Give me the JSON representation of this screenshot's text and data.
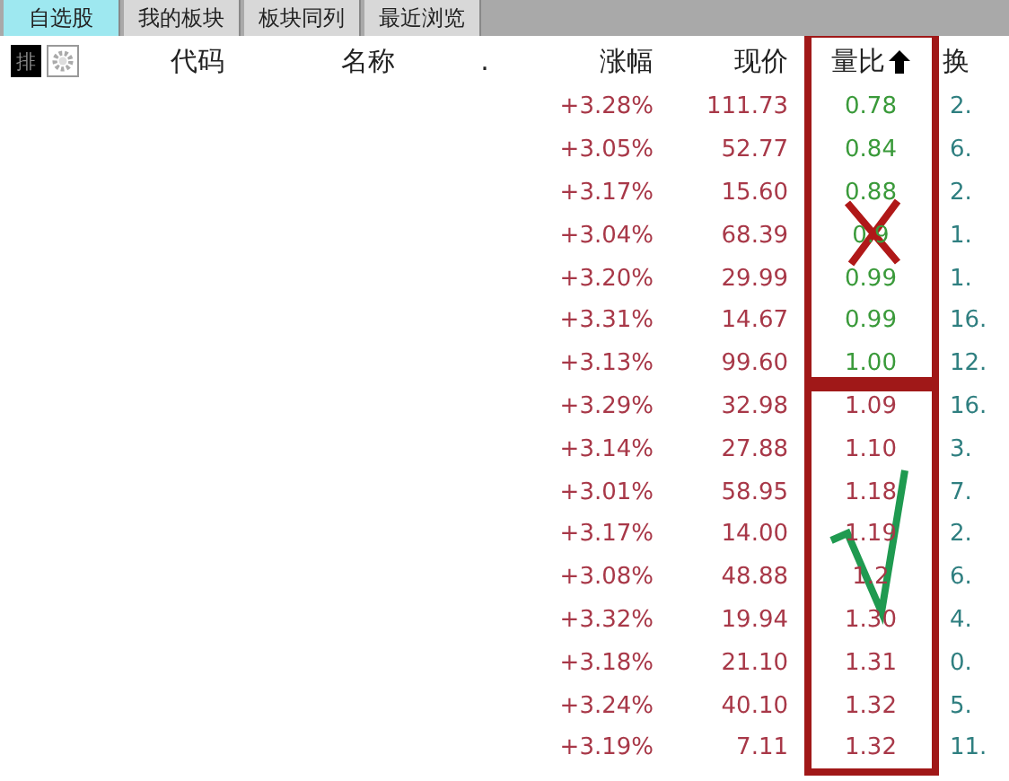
{
  "tabs": [
    {
      "label": "自选股",
      "selected": true
    },
    {
      "label": "我的板块",
      "selected": false
    },
    {
      "label": "板块同列",
      "selected": false
    },
    {
      "label": "最近浏览",
      "selected": false
    }
  ],
  "toolbar": {
    "sort_key": "排"
  },
  "columns": [
    {
      "label": "代码",
      "sorted": false
    },
    {
      "label": "名称",
      "sorted": false
    },
    {
      "label": ".",
      "sorted": false
    },
    {
      "label": "涨幅",
      "sorted": false
    },
    {
      "label": "现价",
      "sorted": false
    },
    {
      "label": "量比",
      "sorted": true
    },
    {
      "label": "换",
      "sorted": false
    }
  ],
  "rows": [
    {
      "change": "+3.28%",
      "price": "111.73",
      "ratio": "0.78",
      "color": "#3a9a3a",
      "column_7": "2."
    },
    {
      "change": "+3.05%",
      "price": "52.77",
      "ratio": "0.84",
      "color": "#3a9a3a",
      "column_7": "6."
    },
    {
      "change": "+3.17%",
      "price": "15.60",
      "ratio": "0.88",
      "color": "#3a9a3a",
      "column_7": "2."
    },
    {
      "change": "+3.04%",
      "price": "68.39",
      "ratio": "0.9",
      "color": "#3a9a3a",
      "column_7": "1."
    },
    {
      "change": "+3.20%",
      "price": "29.99",
      "ratio": "0.99",
      "color": "#3a9a3a",
      "column_7": "1."
    },
    {
      "change": "+3.31%",
      "price": "14.67",
      "ratio": "0.99",
      "color": "#3a9a3a",
      "column_7": "16."
    },
    {
      "change": "+3.13%",
      "price": "99.60",
      "ratio": "1.00",
      "color": "#3a9a3a",
      "column_7": "12."
    },
    {
      "change": "+3.29%",
      "price": "32.98",
      "ratio": "1.09",
      "color": "#a83848",
      "column_7": "16."
    },
    {
      "change": "+3.14%",
      "price": "27.88",
      "ratio": "1.10",
      "color": "#a83848",
      "column_7": "3."
    },
    {
      "change": "+3.01%",
      "price": "58.95",
      "ratio": "1.18",
      "color": "#a83848",
      "column_7": "7."
    },
    {
      "change": "+3.17%",
      "price": "14.00",
      "ratio": "1.19",
      "color": "#a83848",
      "column_7": "2."
    },
    {
      "change": "+3.08%",
      "price": "48.88",
      "ratio": "1.2",
      "color": "#a83848",
      "column_7": "6."
    },
    {
      "change": "+3.32%",
      "price": "19.94",
      "ratio": "1.30",
      "color": "#a83848",
      "column_7": "4."
    },
    {
      "change": "+3.18%",
      "price": "21.10",
      "ratio": "1.31",
      "color": "#a83848",
      "column_7": "0."
    },
    {
      "change": "+3.24%",
      "price": "40.10",
      "ratio": "1.32",
      "color": "#a83848",
      "column_7": "5."
    },
    {
      "change": "+3.19%",
      "price": "7.11",
      "ratio": "1.32",
      "color": "#a83848",
      "column_7": "11."
    }
  ]
}
